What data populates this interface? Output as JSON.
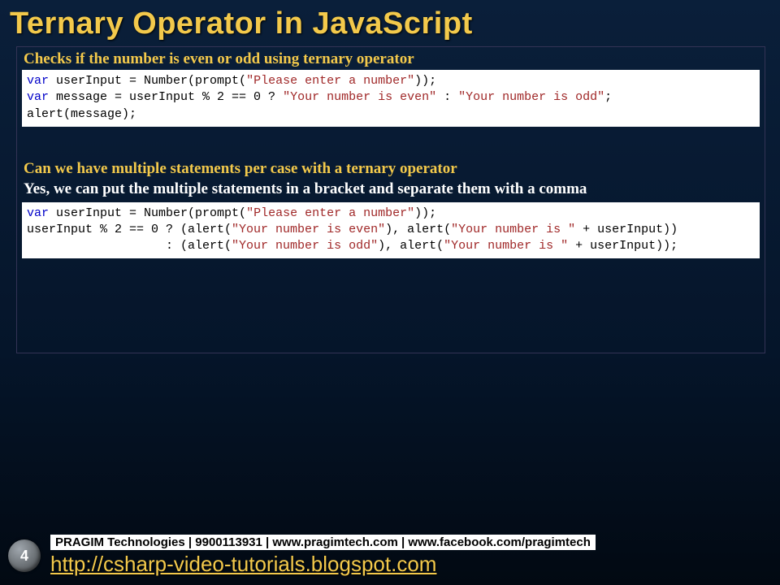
{
  "title": "Ternary Operator in JavaScript",
  "section1": {
    "heading": "Checks if the number is even or odd using ternary operator",
    "code_tokens": [
      {
        "t": "var ",
        "c": "kw"
      },
      {
        "t": "userInput = Number(prompt(",
        "c": "nm"
      },
      {
        "t": "\"Please enter a number\"",
        "c": "str"
      },
      {
        "t": "));",
        "c": "nm"
      },
      {
        "t": "\n"
      },
      {
        "t": "var ",
        "c": "kw"
      },
      {
        "t": "message = userInput % 2 == 0 ? ",
        "c": "nm"
      },
      {
        "t": "\"Your number is even\"",
        "c": "str"
      },
      {
        "t": " : ",
        "c": "nm"
      },
      {
        "t": "\"Your number is odd\"",
        "c": "str"
      },
      {
        "t": ";",
        "c": "nm"
      },
      {
        "t": "\n"
      },
      {
        "t": "alert(message);",
        "c": "nm"
      }
    ]
  },
  "section2": {
    "heading": "Can we have multiple statements per case with a ternary operator",
    "body": "Yes, we can put the multiple statements in a bracket and separate them with a comma",
    "code_tokens": [
      {
        "t": "var ",
        "c": "kw"
      },
      {
        "t": "userInput = Number(prompt(",
        "c": "nm"
      },
      {
        "t": "\"Please enter a number\"",
        "c": "str"
      },
      {
        "t": "));",
        "c": "nm"
      },
      {
        "t": "\n"
      },
      {
        "t": "userInput % 2 == 0 ? (alert(",
        "c": "nm"
      },
      {
        "t": "\"Your number is even\"",
        "c": "str"
      },
      {
        "t": "), alert(",
        "c": "nm"
      },
      {
        "t": "\"Your number is \"",
        "c": "str"
      },
      {
        "t": " + userInput))",
        "c": "nm"
      },
      {
        "t": "\n"
      },
      {
        "t": "                   : (alert(",
        "c": "nm"
      },
      {
        "t": "\"Your number is odd\"",
        "c": "str"
      },
      {
        "t": "), alert(",
        "c": "nm"
      },
      {
        "t": "\"Your number is \"",
        "c": "str"
      },
      {
        "t": " + userInput));",
        "c": "nm"
      }
    ]
  },
  "footer": {
    "page_number": "4",
    "info_line": "PRAGIM Technologies | 9900113931 | www.pragimtech.com | www.facebook.com/pragimtech",
    "link_text": "http://csharp-video-tutorials.blogspot.com"
  }
}
